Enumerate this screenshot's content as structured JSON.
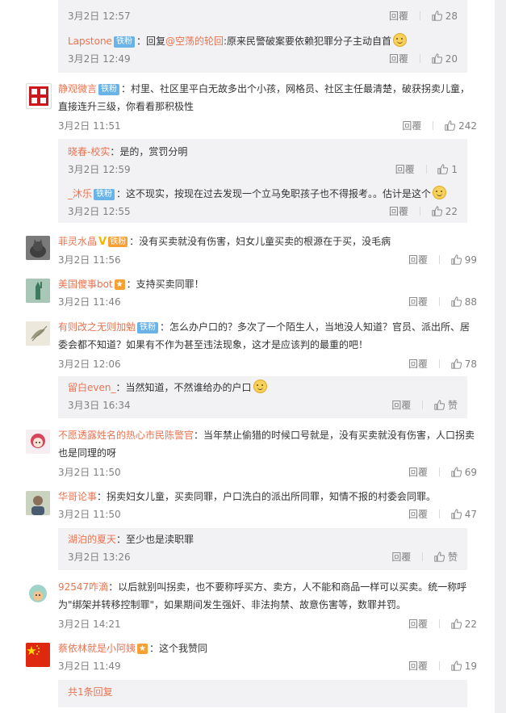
{
  "ui": {
    "reply_label": "回覆",
    "like_label": "赞"
  },
  "top_subs": [
    {
      "time": "3月2日 12:57",
      "likes": "28"
    },
    {
      "name": "Lapstone",
      "badge": "铁粉",
      "prefix": "：回复",
      "mention": "@空荡的轮回",
      "text": ":原来民警破案要依赖犯罪分子主动自首",
      "time": "3月2日 12:49",
      "likes": "20"
    }
  ],
  "comments": [
    {
      "name": "静观微言",
      "badge": "铁粉",
      "text": "：村里、社区里平白无故多出个小孩，网格员、社区主任最清楚，破获拐卖儿童，直接连升三级，你看看那积极性",
      "time": "3月2日 11:51",
      "likes": "242",
      "subs": [
        {
          "name": "晓春-校实",
          "text": "：是的，赏罚分明",
          "time": "3月2日 12:59",
          "likes": "1"
        },
        {
          "name": "_沐乐",
          "badge": "铁粉",
          "text": "：这不现实，按现在过去发现一个立马免职孩子也不得报考。。估计是这个",
          "time": "3月2日 12:55",
          "likes": "22"
        }
      ]
    },
    {
      "name": "菲灵水晶",
      "vmark": "V",
      "vip": "铁粉",
      "text": "：没有买卖就没有伤害，妇女儿童买卖的根源在于买，没毛病",
      "time": "3月2日 11:56",
      "likes": "99"
    },
    {
      "name": "美国傻事bot",
      "text": "：支持买卖同罪！",
      "time": "3月2日 11:46",
      "likes": "88"
    },
    {
      "name": "有则改之无则加勉",
      "badge": "铁粉",
      "text": "：怎么办户口的？多次了一个陌生人，当地没人知道？官员、派出所、居委会都不知道？如果有不作为甚至违法现象，这才是应该判的最重的吧！",
      "time": "3月2日 12:06",
      "likes": "78",
      "subs": [
        {
          "name": "留白even_",
          "text": "：当然知道，不然谁给办的户口",
          "time": "3月3日 16:34",
          "likes": "赞"
        }
      ]
    },
    {
      "name": "不愿透露姓名的热心市民陈警官",
      "text": "：当年禁止偷猎的时候口号就是，没有买卖就没有伤害，人口拐卖也是同理的呀",
      "time": "3月2日 11:50",
      "likes": "69"
    },
    {
      "name": "华哥论事",
      "text": "：拐卖妇女儿童，买卖同罪，户口洗白的派出所同罪，知情不报的村委会同罪。",
      "time": "3月2日 11:50",
      "likes": "47",
      "subs": [
        {
          "name": "湖泊的夏天",
          "text": "：至少也是渎职罪",
          "time": "3月2日 13:26",
          "likes": "赞"
        }
      ]
    },
    {
      "name": "92547咋滴",
      "text": "：以后就别叫拐卖，也不要称呼买方、卖方，人不能和商品一样可以买卖。统一称呼为\"绑架并转移控制罪\"，如果期间发生强奸、非法拘禁、故意伤害等，数罪并罚。",
      "time": "3月2日 14:21",
      "likes": "22"
    },
    {
      "name": "蔡依林就是小阿姨",
      "text": "：这个我赞同",
      "time": "3月2日 11:49",
      "likes": "19"
    }
  ],
  "more_replies": "共1条回复",
  "colors": {
    "name": "#eb7350",
    "badge": "#69b3e7",
    "subbox": "#f2f2f5",
    "meta": "#808080"
  }
}
